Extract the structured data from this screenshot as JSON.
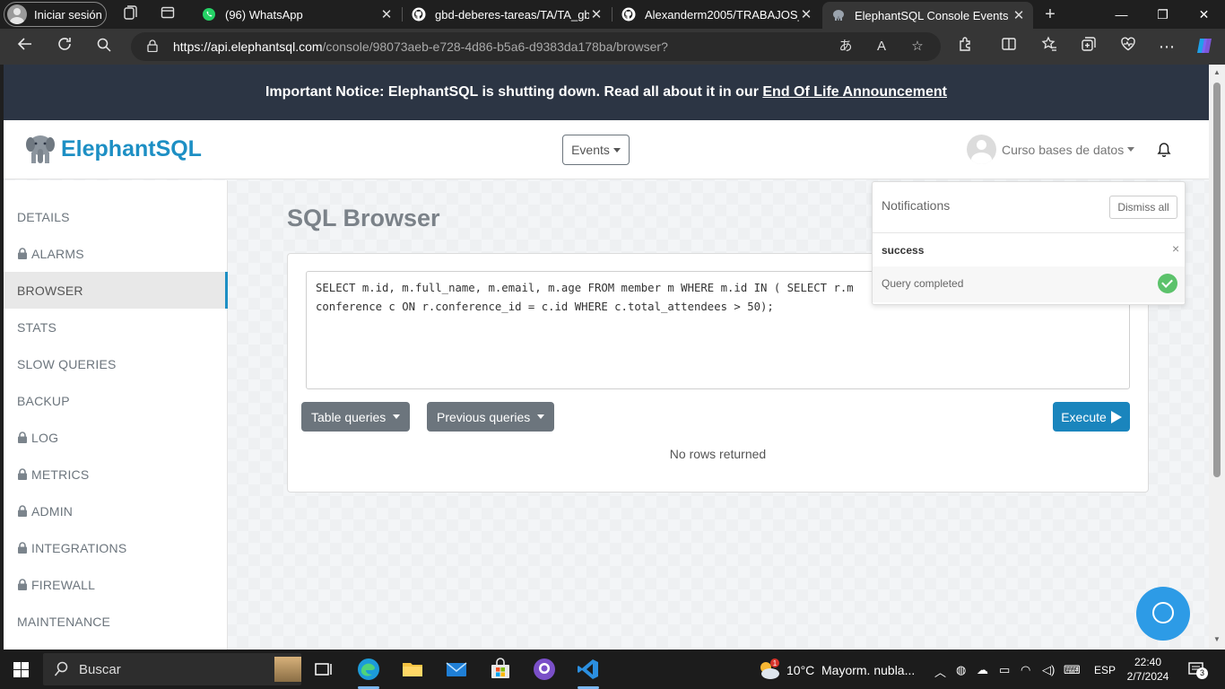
{
  "browser": {
    "profile_label": "Iniciar sesión",
    "tabs": [
      {
        "label": "(96) WhatsApp",
        "icon": "whatsapp-icon"
      },
      {
        "label": "gbd-deberes-tareas/TA/TA_gbd",
        "icon": "github-icon"
      },
      {
        "label": "Alexanderm2005/TRABAJOS_BA",
        "icon": "github-icon"
      },
      {
        "label": "ElephantSQL Console Events",
        "icon": "elephant-icon",
        "active": true
      }
    ],
    "new_tab_label": "+",
    "url_host": "https://api.elephantsql.com",
    "url_path": "/console/98073aeb-e728-4d86-b5a6-d9383da178ba/browser?"
  },
  "notice": {
    "text": "Important Notice: ElephantSQL is shutting down. Read all about it in our ",
    "link": "End Of Life Announcement"
  },
  "header": {
    "brand": "ElephantSQL",
    "events_label": "Events",
    "user_label": "Curso bases de datos"
  },
  "sidebar": {
    "items": [
      {
        "label": "DETAILS",
        "locked": false
      },
      {
        "label": "ALARMS",
        "locked": true
      },
      {
        "label": "BROWSER",
        "locked": false,
        "active": true
      },
      {
        "label": "STATS",
        "locked": false
      },
      {
        "label": "SLOW QUERIES",
        "locked": false
      },
      {
        "label": "BACKUP",
        "locked": false
      },
      {
        "label": "LOG",
        "locked": true
      },
      {
        "label": "METRICS",
        "locked": true
      },
      {
        "label": "ADMIN",
        "locked": true
      },
      {
        "label": "INTEGRATIONS",
        "locked": true
      },
      {
        "label": "FIREWALL",
        "locked": true
      },
      {
        "label": "MAINTENANCE",
        "locked": false
      }
    ]
  },
  "main": {
    "title": "SQL Browser",
    "query": "SELECT m.id, m.full_name, m.email, m.age FROM member m WHERE m.id IN ( SELECT r.m\nconference c ON r.conference_id = c.id WHERE c.total_attendees > 50);",
    "table_queries_label": "Table queries",
    "previous_queries_label": "Previous queries",
    "execute_label": "Execute",
    "result_text": "No rows returned"
  },
  "notifications": {
    "title": "Notifications",
    "dismiss_label": "Dismiss all",
    "status": "success",
    "close_glyph": "×",
    "message": "Query completed"
  },
  "taskbar": {
    "search_placeholder": "Buscar",
    "weather_temp": "10°C",
    "weather_desc": "Mayorm. nubla...",
    "weather_badge": "1",
    "language": "ESP",
    "time": "22:40",
    "date": "2/7/2024",
    "notification_count": "3"
  },
  "colors": {
    "brand": "#1d8fc4",
    "notice_bg": "#2c3544",
    "execute_bg": "#1a85bd",
    "button_grey": "#6c757d",
    "success": "#5cc26b"
  }
}
